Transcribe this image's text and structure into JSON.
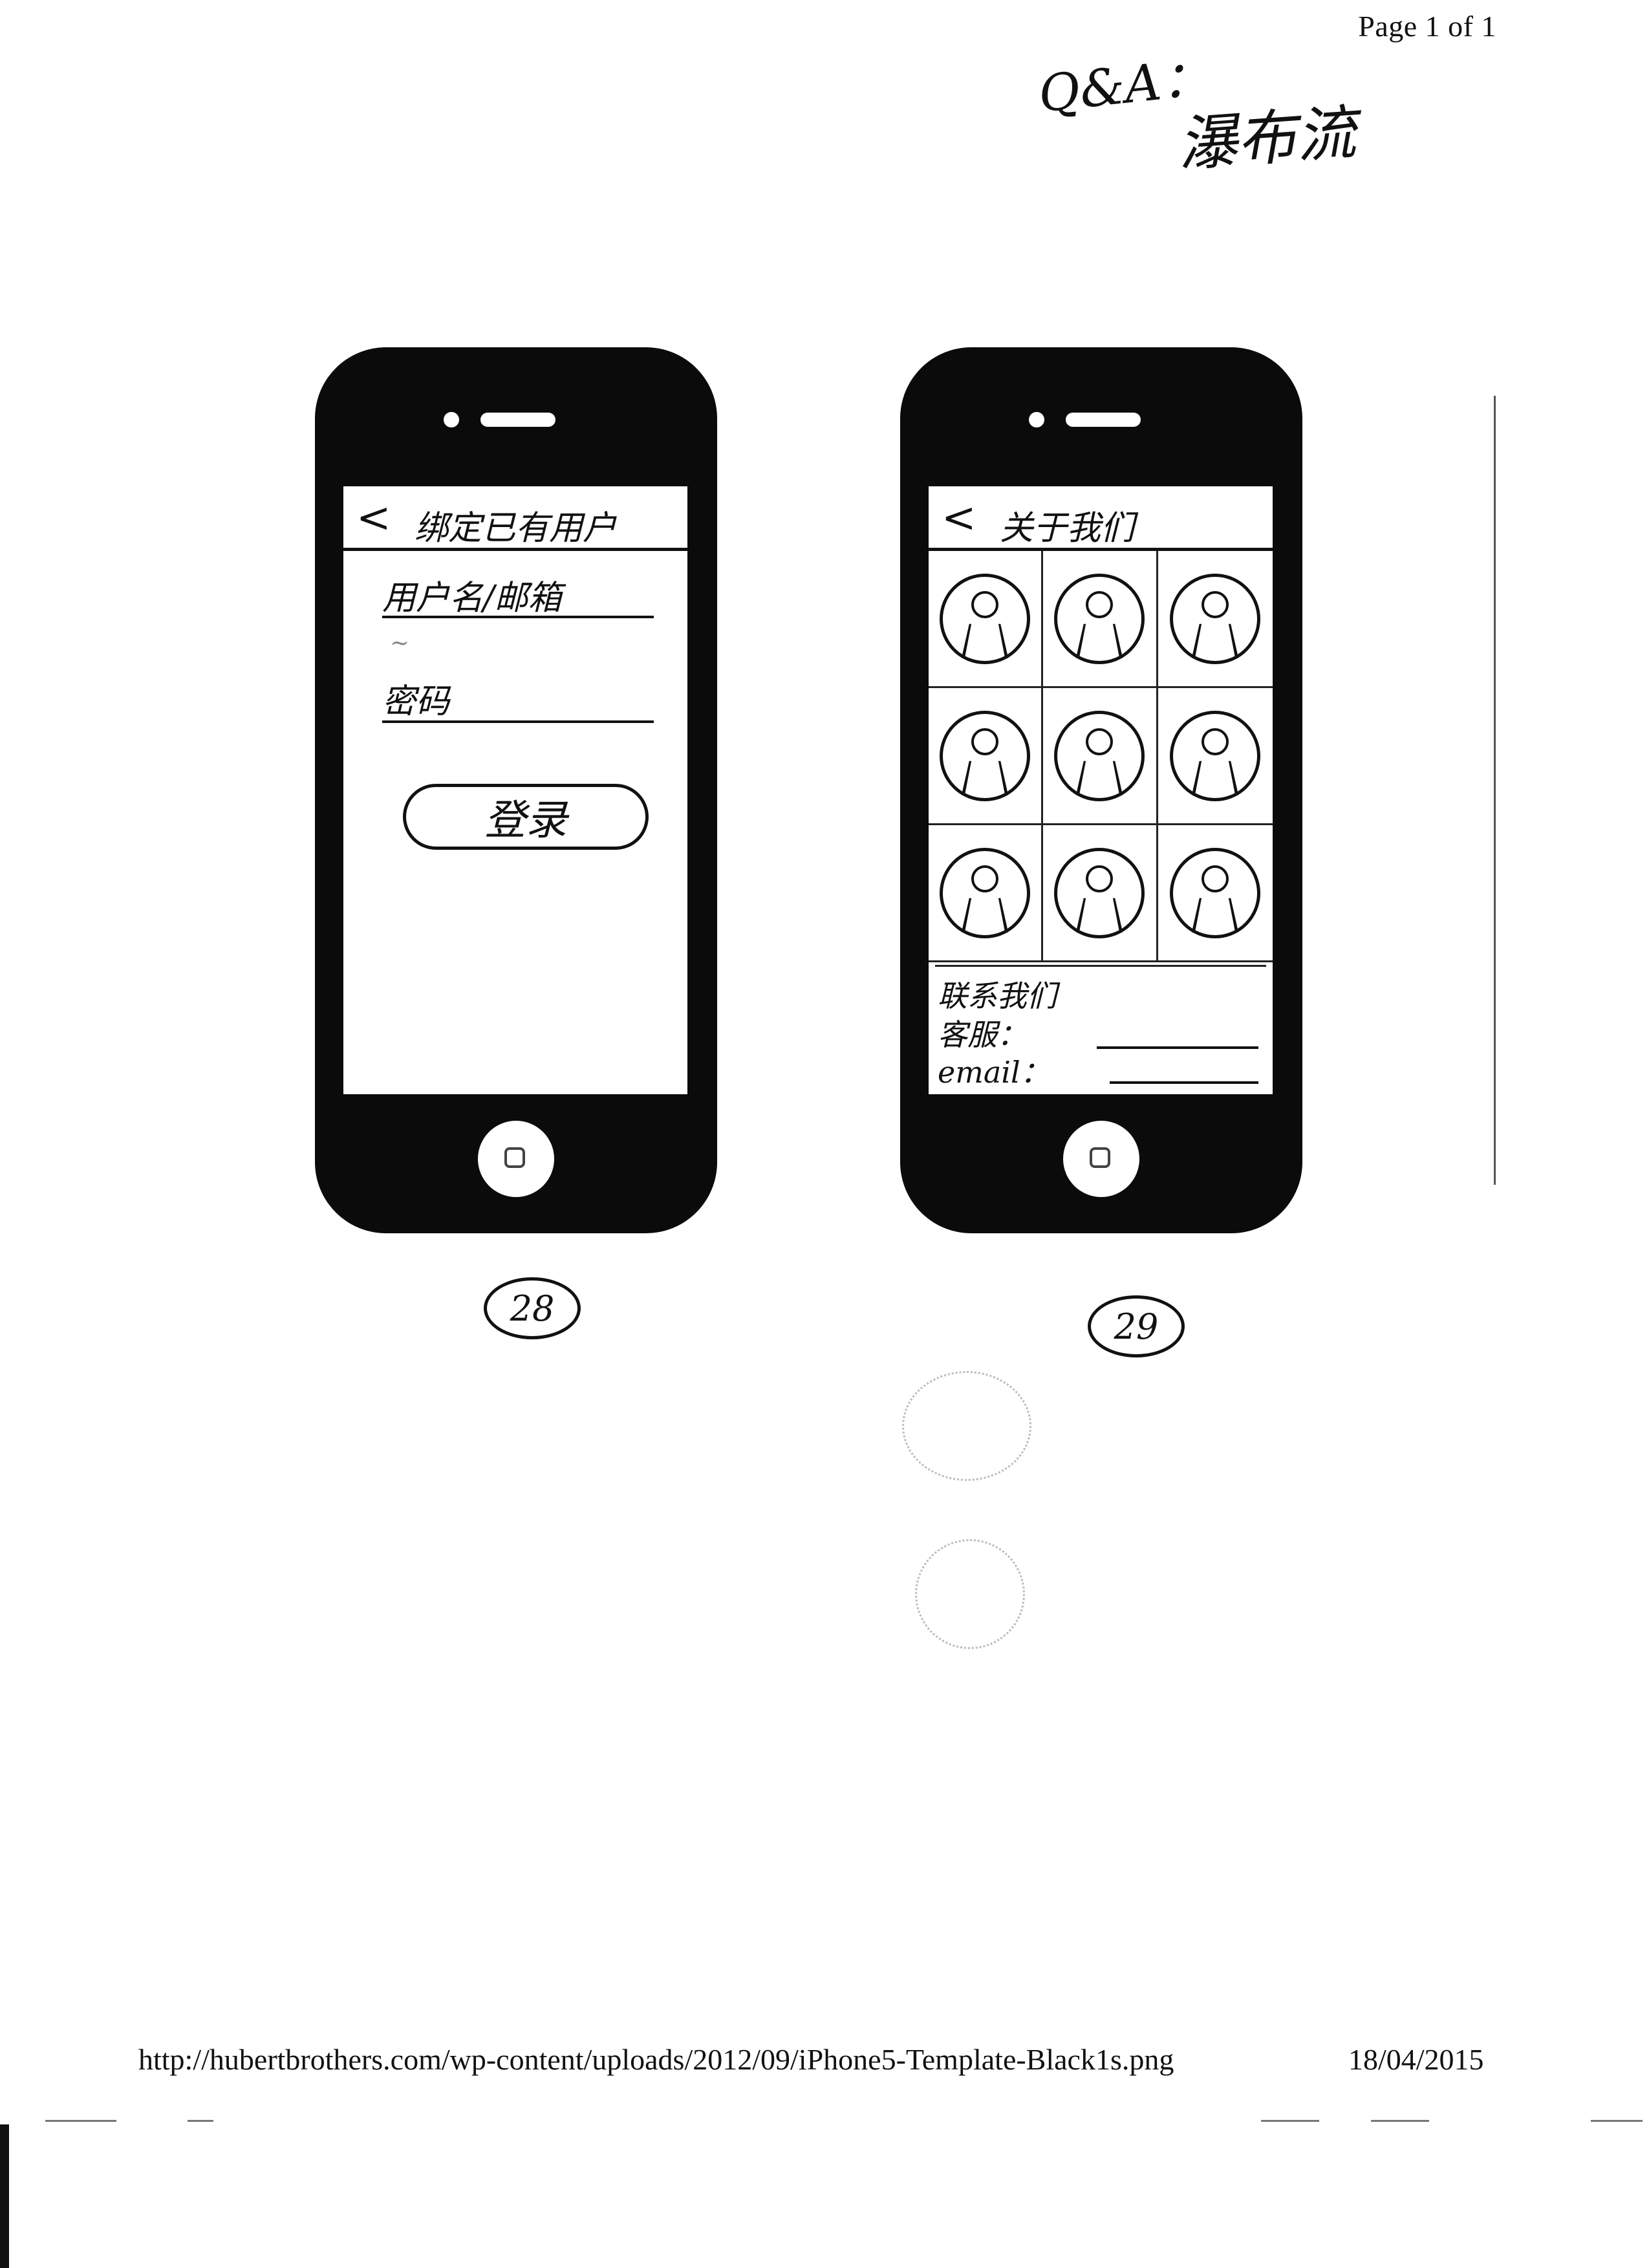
{
  "header": {
    "page_label": "Page 1 of 1"
  },
  "top_note": {
    "line1": "Q&A：",
    "line2": "瀑布流"
  },
  "phone_28": {
    "nav": {
      "back_glyph": "<",
      "title": "绑定已有用户"
    },
    "username_label": "用户名/邮箱",
    "password_label": "密码",
    "login_button_label": "登录",
    "page_number": "28"
  },
  "phone_29": {
    "nav": {
      "back_glyph": "<",
      "title": "关于我们"
    },
    "grid": [
      {
        "icon": "person-avatar-icon"
      },
      {
        "icon": "person-avatar-icon"
      },
      {
        "icon": "person-avatar-icon"
      },
      {
        "icon": "person-avatar-icon"
      },
      {
        "icon": "person-avatar-icon"
      },
      {
        "icon": "person-avatar-icon"
      },
      {
        "icon": "person-avatar-icon"
      },
      {
        "icon": "person-avatar-icon"
      },
      {
        "icon": "person-avatar-icon"
      }
    ],
    "contact_heading": "联系我们",
    "service_label": "客服：",
    "email_label": "email：",
    "page_number": "29"
  },
  "footer": {
    "url": "http://hubertbrothers.com/wp-content/uploads/2012/09/iPhone5-Template-Black1s.png",
    "date": "18/04/2015"
  }
}
